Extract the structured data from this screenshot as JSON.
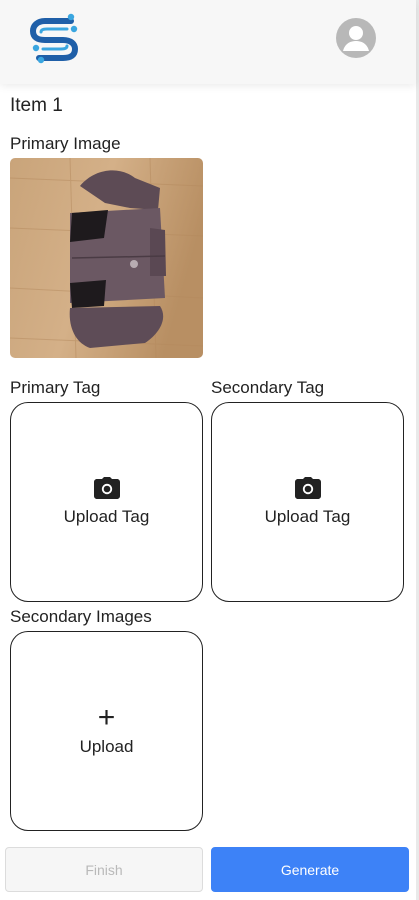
{
  "header": {
    "logo_icon": "s-circuit-logo-icon",
    "avatar_icon": "user-avatar-icon"
  },
  "item": {
    "title": "Item 1",
    "primary_image_label": "Primary Image",
    "primary_tag_label": "Primary Tag",
    "secondary_tag_label": "Secondary Tag",
    "primary_tag_upload": "Upload Tag",
    "secondary_tag_upload": "Upload Tag",
    "secondary_images_label": "Secondary Images",
    "secondary_images_upload": "Upload"
  },
  "footer": {
    "finish_label": "Finish",
    "generate_label": "Generate"
  },
  "colors": {
    "accent": "#3d82f7",
    "logo_dark": "#1f5fa8",
    "logo_light": "#3aa6e0"
  }
}
